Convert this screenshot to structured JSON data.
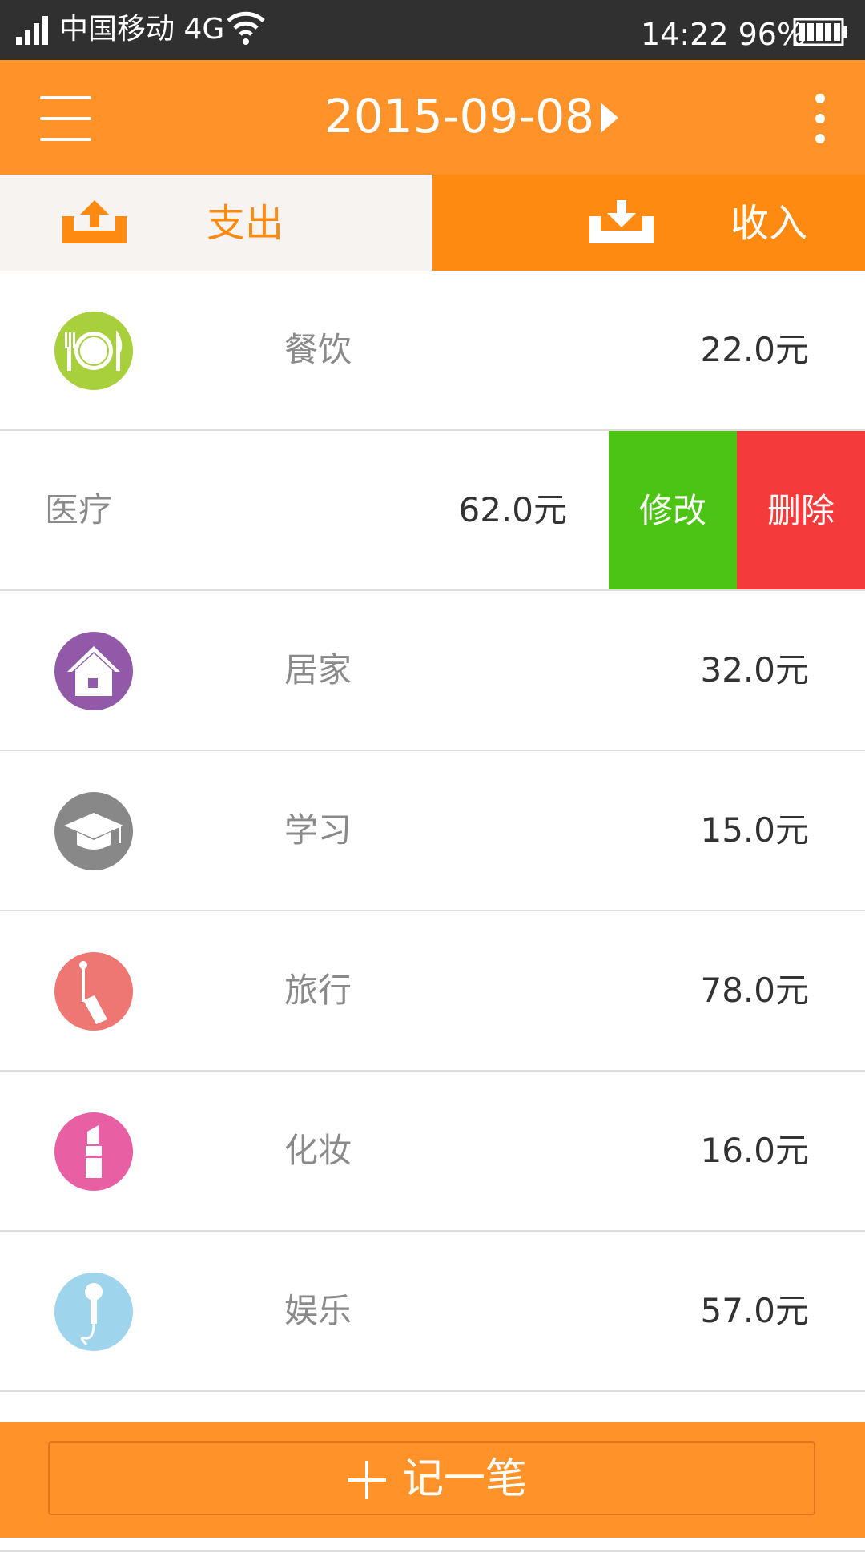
{
  "status_bar": {
    "carrier": "中国移动 4G",
    "time_battery": "14:22 96%",
    "icons": [
      "signal-icon",
      "wifi-icon",
      "battery-icon"
    ]
  },
  "header": {
    "date": "2015-09-08",
    "icons": [
      "menu-icon",
      "next-date-icon",
      "more-icon"
    ],
    "color": "#ff9228"
  },
  "tabs": {
    "expense_label": "支出",
    "income_label": "收入",
    "expense_icon": "upload-icon",
    "income_icon": "download-icon"
  },
  "records": [
    {
      "category": "餐饮",
      "amount": "22.0元",
      "icon": "dining-icon",
      "icon_color": "#a8cf3c"
    },
    {
      "category": "医疗",
      "amount": "62.0元",
      "swiped": true
    },
    {
      "category": "居家",
      "amount": "32.0元",
      "icon": "home-icon",
      "icon_color": "#9159a8"
    },
    {
      "category": "学习",
      "amount": "15.0元",
      "icon": "graduation-cap-icon",
      "icon_color": "#888888"
    },
    {
      "category": "旅行",
      "amount": "78.0元",
      "icon": "luggage-icon",
      "icon_color": "#ee7673"
    },
    {
      "category": "化妆",
      "amount": "16.0元",
      "icon": "lipstick-icon",
      "icon_color": "#e85fa4"
    },
    {
      "category": "娱乐",
      "amount": "57.0元",
      "icon": "microphone-icon",
      "icon_color": "#9ed4ec"
    }
  ],
  "row_actions": {
    "edit_label": "修改",
    "delete_label": "删除",
    "edit_color": "#4cc414",
    "delete_color": "#f43a3a"
  },
  "bottom": {
    "add_label": "记一笔",
    "add_icon": "plus-icon"
  }
}
